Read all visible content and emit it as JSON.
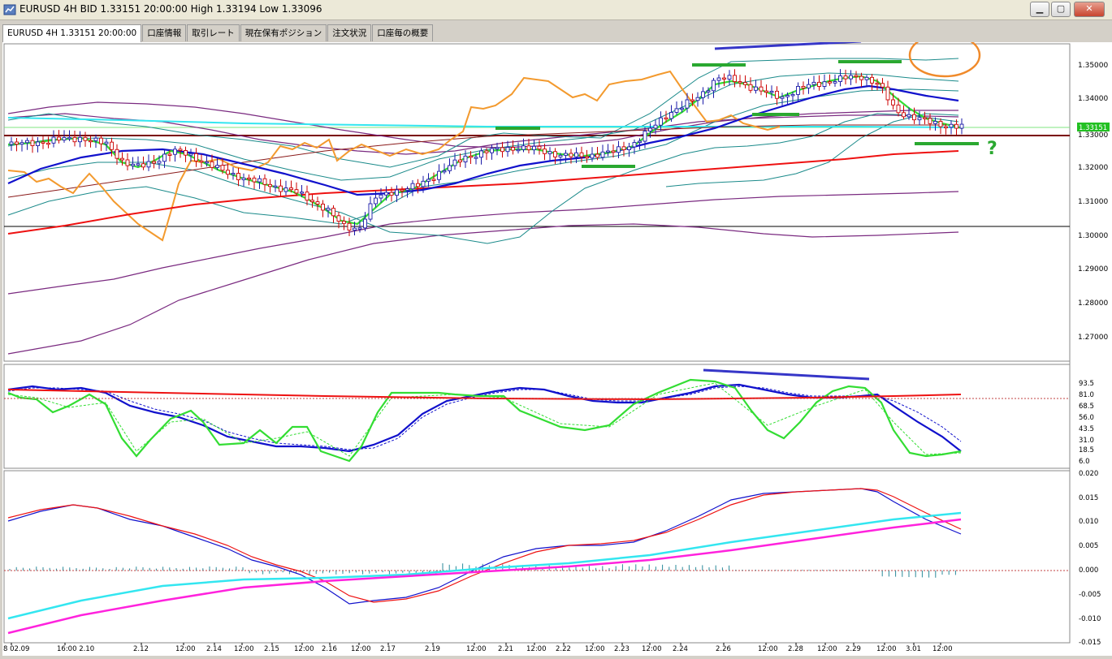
{
  "window": {
    "title": "EURUSD 4H BID 1.33151 20:00:00 High 1.33194 Low 1.33096",
    "buttons": {
      "minimize": "▁",
      "restore": "▢",
      "close": "✕"
    }
  },
  "tabs": [
    {
      "label": "EURUSD 4H 1.33151 20:00:00",
      "active": true
    },
    {
      "label": "口座情報",
      "active": false
    },
    {
      "label": "取引レート",
      "active": false
    },
    {
      "label": "現在保有ポジション",
      "active": false
    },
    {
      "label": "注文状況",
      "active": false
    },
    {
      "label": "口座毎の概要",
      "active": false
    }
  ],
  "price_axis": {
    "ticks": [
      "1.35000",
      "1.34000",
      "1.33000",
      "1.32000",
      "1.31000",
      "1.30000",
      "1.29000",
      "1.28000",
      "1.27000"
    ],
    "current_price": "1.33151"
  },
  "stoch_axis": {
    "ticks": [
      "93.5",
      "81.0",
      "68.5",
      "56.0",
      "43.5",
      "31.0",
      "18.5",
      "6.0"
    ]
  },
  "macd_axis": {
    "ticks": [
      "0.020",
      "0.015",
      "0.010",
      "0.005",
      "0.000",
      "-0.005",
      "-0.010",
      "-0.015"
    ]
  },
  "time_axis": {
    "labels": [
      "8 02.09",
      "16:00 2.10",
      "2.12",
      "12:00",
      "2.14",
      "12:00",
      "2.15",
      "12:00",
      "2.16",
      "12:00",
      "2.17",
      "2.19",
      "12:00",
      "2.21",
      "12:00",
      "2.22",
      "12:00",
      "2.23",
      "12:00",
      "2.24",
      "2.26",
      "12:00",
      "2.28",
      "12:00",
      "2.29",
      "12:00",
      "3.01",
      "12:00"
    ]
  },
  "annotation": {
    "question_mark": "?"
  },
  "colors": {
    "candle_up": "#000000",
    "candle_down": "#cc0000",
    "ema_fast": "#33dd33",
    "ema_mid": "#1111cc",
    "ema_slow": "#ee1111",
    "orange_line": "#f39a2e",
    "cyan_line": "#33e6f0",
    "annotation_green": "#2aa830",
    "annotation_blue": "#3636c8"
  }
}
